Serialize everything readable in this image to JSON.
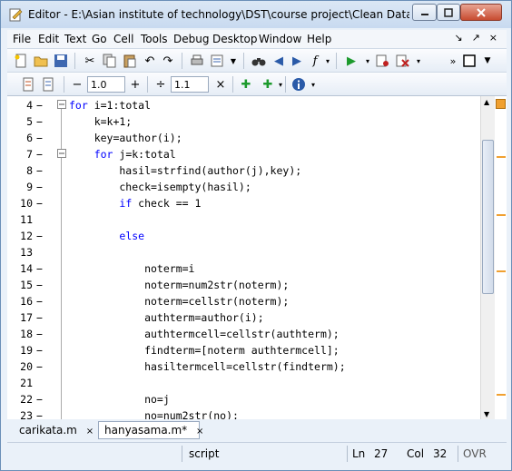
{
  "window": {
    "title": "Editor - E:\\Asian institute of technology\\DST\\course project\\Clean Data\\hany..."
  },
  "menu": {
    "items": [
      {
        "label": "File"
      },
      {
        "label": "Edit"
      },
      {
        "label": "Text"
      },
      {
        "label": "Go"
      },
      {
        "label": "Cell"
      },
      {
        "label": "Tools"
      },
      {
        "label": "Debug"
      },
      {
        "label": "Desktop"
      },
      {
        "label": "Window"
      },
      {
        "label": "Help"
      }
    ]
  },
  "toolbar2": {
    "minus": "−",
    "cell_value1": "1.0",
    "plus": "+",
    "divide": "÷",
    "cell_value2": "1.1",
    "times": "×"
  },
  "code": {
    "lines": [
      {
        "n": "4",
        "dash": "−",
        "text": "for i=1:total"
      },
      {
        "n": "5",
        "dash": "−",
        "text": "    k=k+1;"
      },
      {
        "n": "6",
        "dash": "−",
        "text": "    key=author(i);"
      },
      {
        "n": "7",
        "dash": "−",
        "text": "    for j=k:total"
      },
      {
        "n": "8",
        "dash": "−",
        "text": "        hasil=strfind(author(j),key);"
      },
      {
        "n": "9",
        "dash": "−",
        "text": "        check=isempty(hasil);"
      },
      {
        "n": "10",
        "dash": "−",
        "text": "        if check == 1"
      },
      {
        "n": "11",
        "dash": "",
        "text": ""
      },
      {
        "n": "12",
        "dash": "−",
        "text": "        else"
      },
      {
        "n": "13",
        "dash": "",
        "text": ""
      },
      {
        "n": "14",
        "dash": "−",
        "text": "            noterm=i"
      },
      {
        "n": "15",
        "dash": "−",
        "text": "            noterm=num2str(noterm);"
      },
      {
        "n": "16",
        "dash": "−",
        "text": "            noterm=cellstr(noterm);"
      },
      {
        "n": "17",
        "dash": "−",
        "text": "            authterm=author(i);"
      },
      {
        "n": "18",
        "dash": "−",
        "text": "            authtermcell=cellstr(authterm);"
      },
      {
        "n": "19",
        "dash": "−",
        "text": "            findterm=[noterm authtermcell];"
      },
      {
        "n": "20",
        "dash": "−",
        "text": "            hasiltermcell=cellstr(findterm);"
      },
      {
        "n": "21",
        "dash": "",
        "text": ""
      },
      {
        "n": "22",
        "dash": "−",
        "text": "            no=j"
      },
      {
        "n": "23",
        "dash": "−",
        "text": "            no=num2str(no);"
      }
    ]
  },
  "tabs": [
    {
      "label": "carikata.m"
    },
    {
      "label": "hanyasama.m*"
    }
  ],
  "status": {
    "mode": "script",
    "ln_label": "Ln",
    "ln_value": "27",
    "col_label": "Col",
    "col_value": "32",
    "ovr": "OVR"
  },
  "colors": {
    "keyword": "#0000ff",
    "warning_marker": "#f0a030"
  }
}
